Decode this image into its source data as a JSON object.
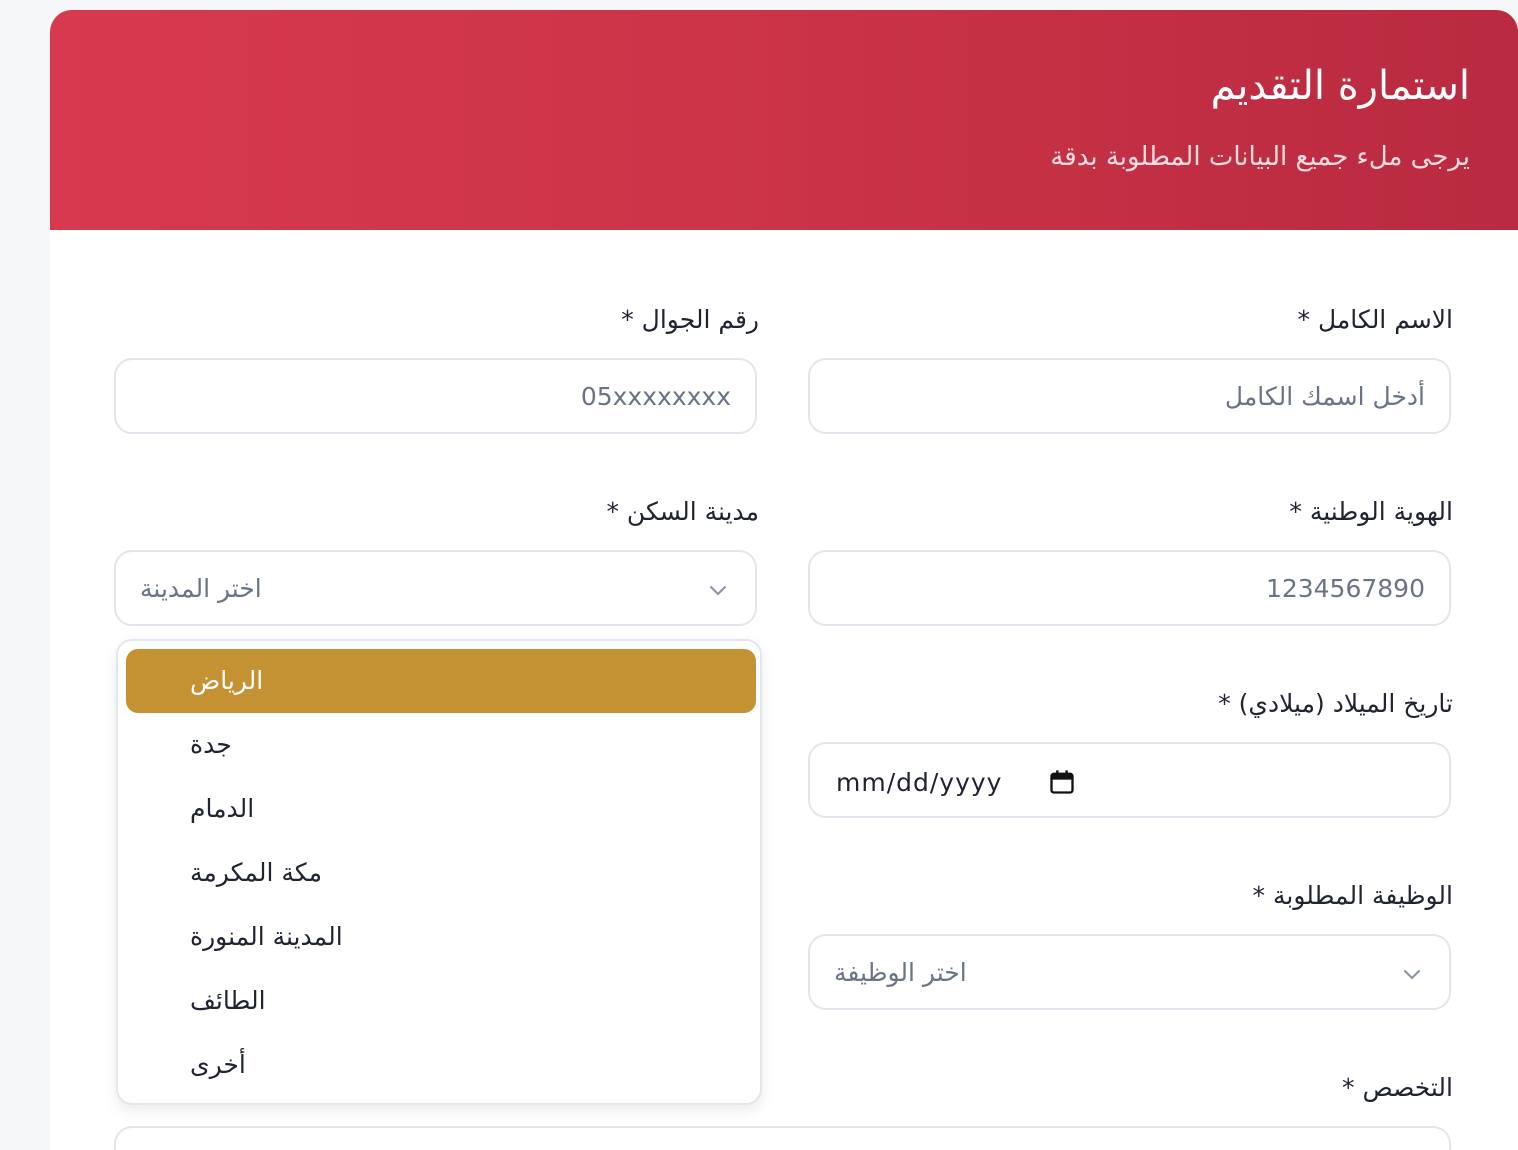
{
  "header": {
    "title": "استمارة التقديم",
    "subtitle": "يرجى ملء جميع البيانات المطلوبة بدقة"
  },
  "form": {
    "full_name": {
      "label": "الاسم الكامل *",
      "placeholder": "أدخل اسمك الكامل"
    },
    "mobile": {
      "label": "رقم الجوال *",
      "placeholder": "05xxxxxxxx"
    },
    "national_id": {
      "label": "الهوية الوطنية *",
      "placeholder": "1234567890"
    },
    "city": {
      "label": "مدينة السكن *",
      "placeholder": "اختر المدينة"
    },
    "birth_date": {
      "label": "تاريخ الميلاد (ميلادي) *",
      "value": "mm/dd/yyyy"
    },
    "job": {
      "label": "الوظيفة المطلوبة *",
      "placeholder": "اختر الوظيفة"
    },
    "specialization": {
      "label": "التخصص *"
    }
  },
  "city_dropdown": {
    "selected": "الرياض",
    "options": [
      "الرياض",
      "جدة",
      "الدمام",
      "مكة المكرمة",
      "المدينة المنورة",
      "الطائف",
      "أخرى"
    ]
  },
  "colors": {
    "header_start": "#d7394e",
    "header_end": "#b92a40",
    "selected_option": "#c49232"
  },
  "icons": {
    "select_arrow": "chevron-down-icon",
    "date_picker": "calendar-icon"
  }
}
